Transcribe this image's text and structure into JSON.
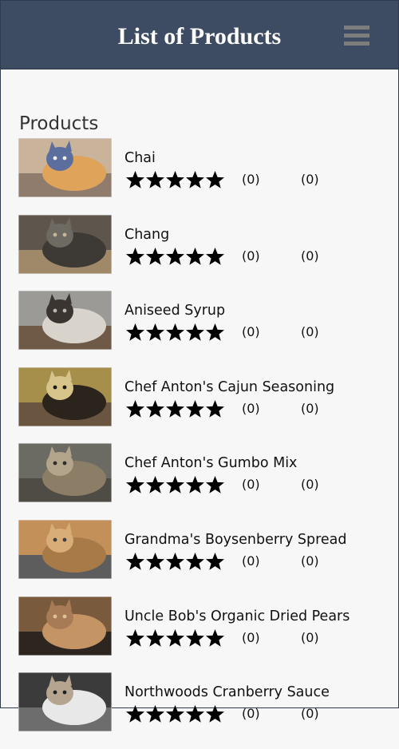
{
  "header": {
    "title": "List of Products",
    "menu_icon": "hamburger-menu-icon"
  },
  "section": {
    "title": "Products"
  },
  "products": [
    {
      "name": "Chai",
      "rating_stars": 5,
      "count_a": "(0)",
      "count_b": "(0)",
      "image": "cat-photo"
    },
    {
      "name": "Chang",
      "rating_stars": 5,
      "count_a": "(0)",
      "count_b": "(0)",
      "image": "cat-photo"
    },
    {
      "name": "Aniseed Syrup",
      "rating_stars": 5,
      "count_a": "(0)",
      "count_b": "(0)",
      "image": "cat-photo"
    },
    {
      "name": "Chef Anton's Cajun Seasoning",
      "rating_stars": 5,
      "count_a": "(0)",
      "count_b": "(0)",
      "image": "cat-photo"
    },
    {
      "name": "Chef Anton's Gumbo Mix",
      "rating_stars": 5,
      "count_a": "(0)",
      "count_b": "(0)",
      "image": "cat-photo"
    },
    {
      "name": "Grandma's Boysenberry Spread",
      "rating_stars": 5,
      "count_a": "(0)",
      "count_b": "(0)",
      "image": "cat-photo"
    },
    {
      "name": "Uncle Bob's Organic Dried Pears",
      "rating_stars": 5,
      "count_a": "(0)",
      "count_b": "(0)",
      "image": "cat-photo"
    },
    {
      "name": "Northwoods Cranberry Sauce",
      "rating_stars": 5,
      "count_a": "(0)",
      "count_b": "(0)",
      "image": "cat-photo"
    }
  ],
  "colors": {
    "header_bg": "#3e4c63",
    "page_bg": "#f7f7f7",
    "star": "#000000"
  }
}
